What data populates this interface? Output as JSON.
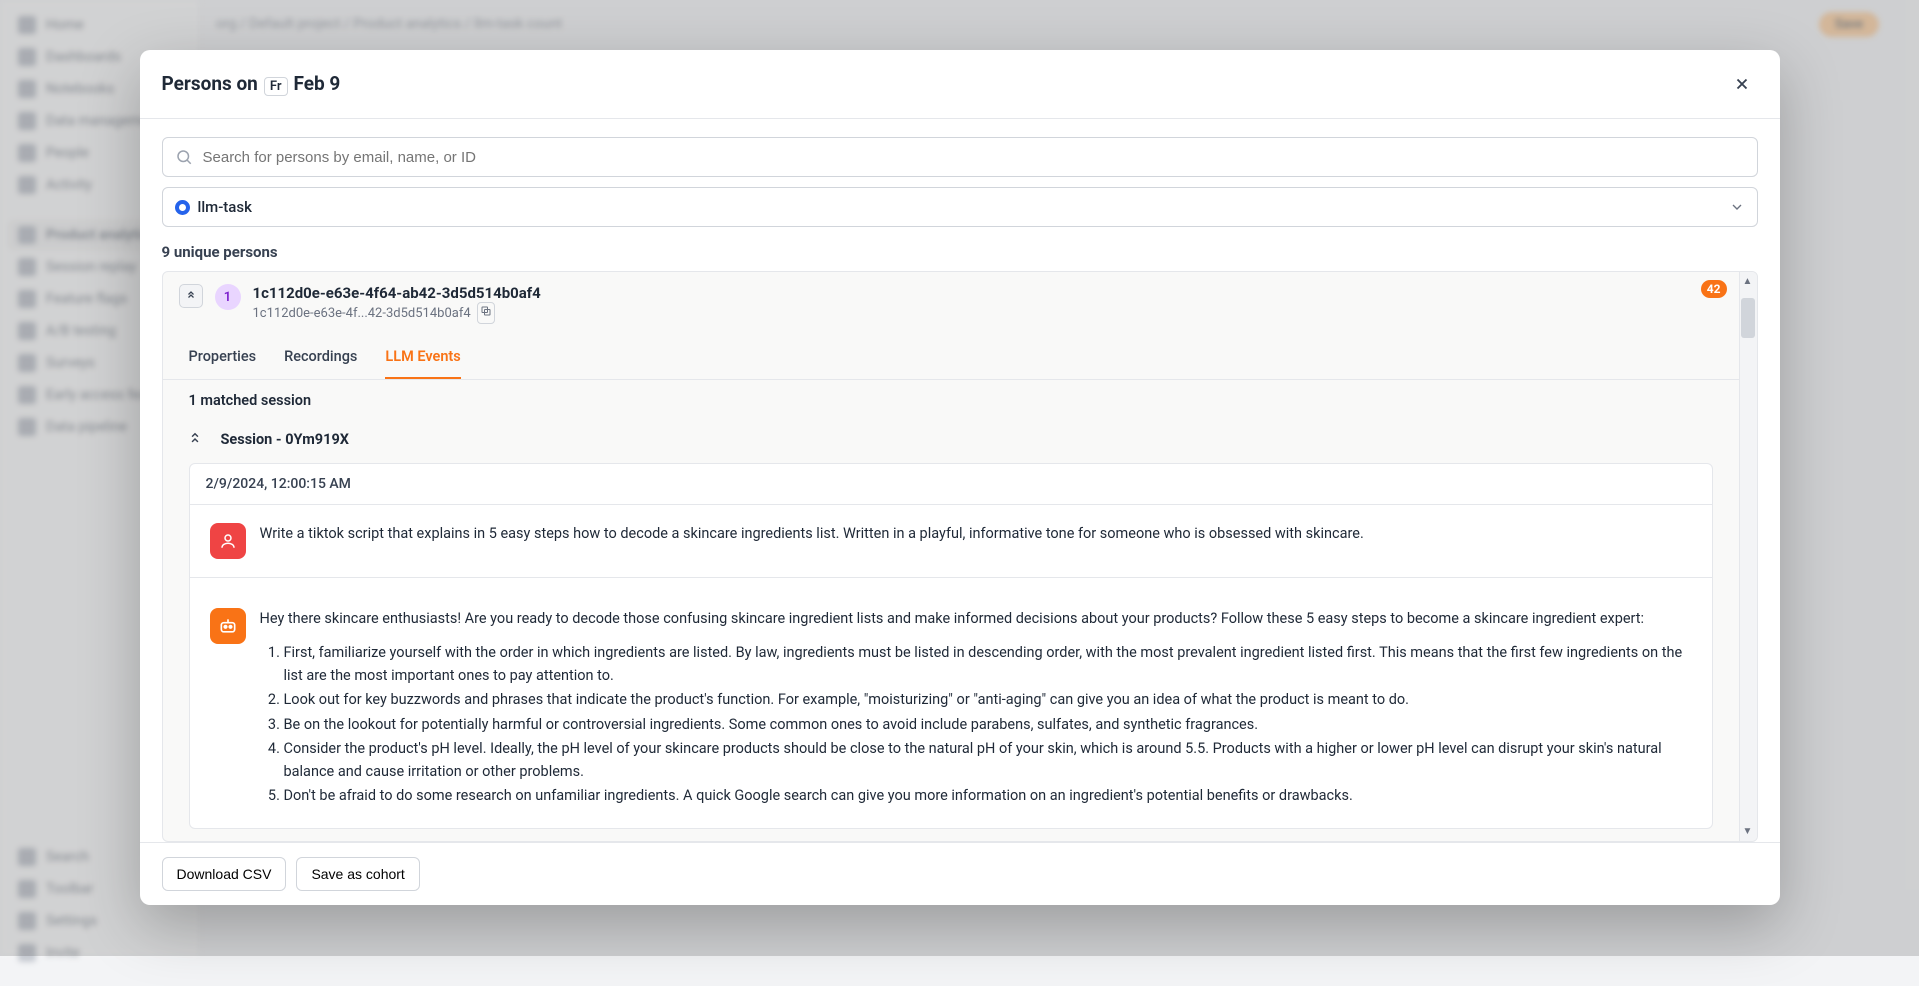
{
  "bg": {
    "sidebar": {
      "groups": [
        {
          "items": [
            "Home",
            "Dashboards",
            "Notebooks",
            "Data management",
            "People",
            "Activity"
          ]
        },
        {
          "items": [
            "Product analytics",
            "Session replay",
            "Feature flags",
            "A/B testing",
            "Surveys",
            "Early access fea...",
            "Data pipeline"
          ]
        },
        {
          "items": [
            "Search",
            "Toolbar",
            "Settings",
            "Invite"
          ]
        }
      ]
    },
    "breadcrumb": "org  /  Default project   /   Product analytics   /   llm-task count",
    "save_btn": "Save"
  },
  "modal": {
    "title_prefix": "Persons on",
    "title_tag": "Fr",
    "title_date": "Feb 9",
    "search_placeholder": "Search for persons by email, name, or ID",
    "filter_label": "llm-task",
    "count_text": "9 unique persons",
    "person": {
      "badge_letter": "1",
      "name": "1c112d0e-e63e-4f64-ab42-3d5d514b0af4",
      "id_short": "1c112d0e-e63e-4f...42-3d5d514b0af4",
      "event_count": "42"
    },
    "tabs": [
      "Properties",
      "Recordings",
      "LLM Events"
    ],
    "active_tab": 2,
    "session_count": "1 matched session",
    "session_label": "Session - 0Ym919X",
    "event": {
      "timestamp": "2/9/2024, 12:00:15 AM",
      "user_msg": "Write a tiktok script that explains in 5 easy steps how to decode a skincare ingredients list. Written in a playful, informative tone for someone who is obsessed with skincare.",
      "bot_intro": "Hey there skincare enthusiasts! Are you ready to decode those confusing skincare ingredient lists and make informed decisions about your products? Follow these 5 easy steps to become a skincare ingredient expert:",
      "bot_steps": [
        "First, familiarize yourself with the order in which ingredients are listed. By law, ingredients must be listed in descending order, with the most prevalent ingredient listed first. This means that the first few ingredients on the list are the most important ones to pay attention to.",
        "Look out for key buzzwords and phrases that indicate the product's function. For example, \"moisturizing\" or \"anti-aging\" can give you an idea of what the product is meant to do.",
        "Be on the lookout for potentially harmful or controversial ingredients. Some common ones to avoid include parabens, sulfates, and synthetic fragrances.",
        "Consider the product's pH level. Ideally, the pH level of your skincare products should be close to the natural pH of your skin, which is around 5.5. Products with a higher or lower pH level can disrupt your skin's natural balance and cause irritation or other problems.",
        "Don't be afraid to do some research on unfamiliar ingredients. A quick Google search can give you more information on an ingredient's potential benefits or drawbacks."
      ]
    },
    "footer": {
      "download": "Download CSV",
      "save_cohort": "Save as cohort"
    }
  }
}
